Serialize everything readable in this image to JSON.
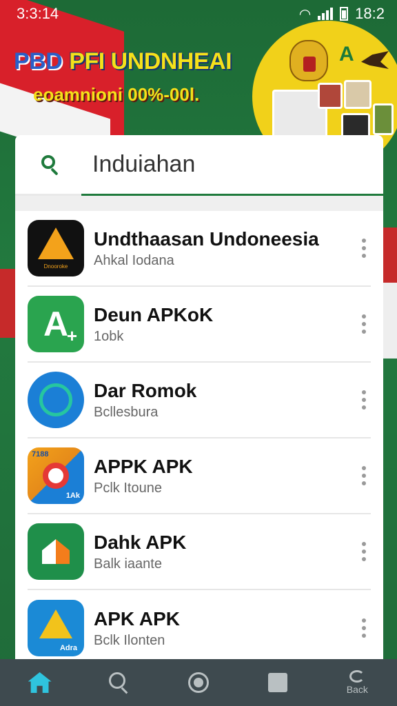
{
  "status_bar": {
    "time": "3:3:14",
    "clock_right": "18:2"
  },
  "banner": {
    "tag": "PBD",
    "title": "PFI UNDNHEAI",
    "subtitle": "eoamnioni 00%-00l."
  },
  "search": {
    "value": "Induiahan",
    "placeholder": "Induiahan"
  },
  "apps": [
    {
      "name": "Undthaasan Undoneesia",
      "subtitle": "Ahkal Iodana",
      "icon": "triangle-a-icon"
    },
    {
      "name": "Deun APKoK",
      "subtitle": "1obk",
      "icon": "green-a-icon"
    },
    {
      "name": "Dar Romok",
      "subtitle": "Bcllesbura",
      "icon": "chat-bubble-icon"
    },
    {
      "name": "APPK APK",
      "subtitle": "Pclk Itoune",
      "icon": "red-circle-icon"
    },
    {
      "name": "Dahk APK",
      "subtitle": "Balk iaante",
      "icon": "house-icon"
    },
    {
      "name": "APK APK",
      "subtitle": "Bclk Ilonten",
      "icon": "multicolor-a-icon"
    }
  ],
  "app_icon_labels": {
    "first": "Dnooroke",
    "fourth_top": "7188",
    "fourth_bottom": "1Ak",
    "sixth": "Adra"
  },
  "bottom_nav": {
    "back_label": "Back"
  },
  "colors": {
    "accent": "#1f7a3c",
    "nav_bg": "#3e4a4f",
    "home_active": "#2fc4de"
  }
}
